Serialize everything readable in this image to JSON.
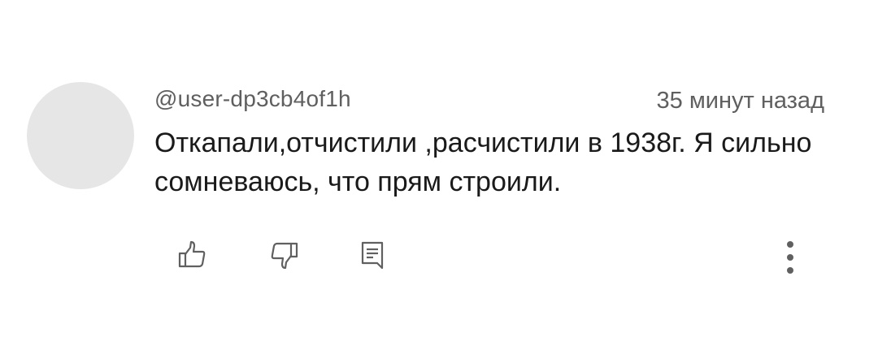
{
  "comment": {
    "author": "@user-dp3cb4of1h",
    "timestamp": "35 минут назад",
    "text": "Откапали,отчистили ,расчистили в 1938г. Я сильно сомневаюсь, что прям строили."
  },
  "actions": {
    "like_icon": "thumb-up-icon",
    "dislike_icon": "thumb-down-icon",
    "reply_icon": "comment-icon",
    "more_icon": "more-vertical-icon"
  },
  "colors": {
    "avatar": "#e6e6e6",
    "secondary_text": "#5f5f5f",
    "primary_text": "#1a1a1a",
    "icon": "#606060"
  }
}
